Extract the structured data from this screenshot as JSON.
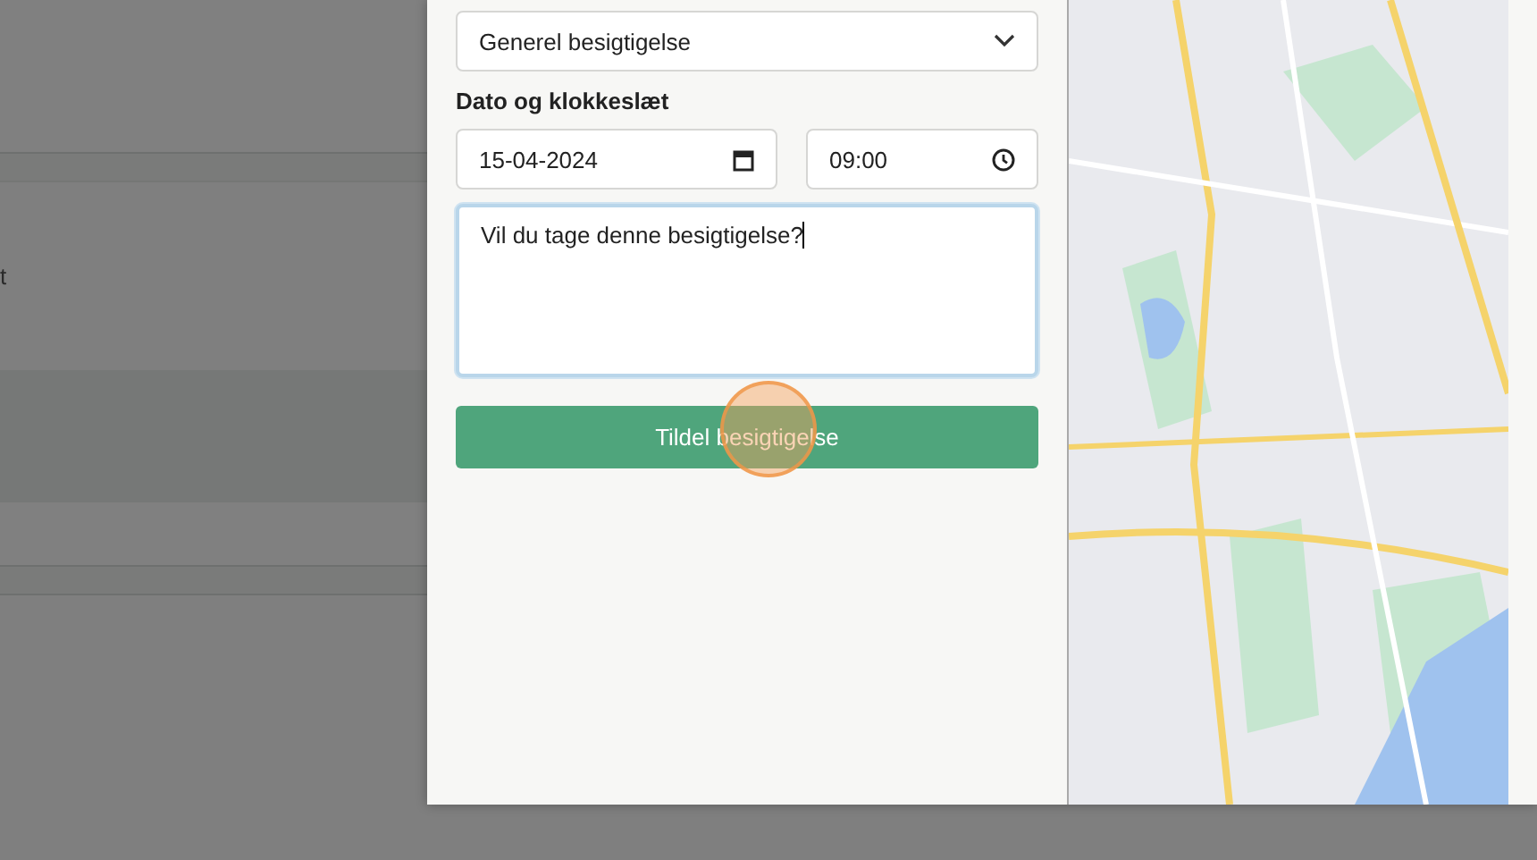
{
  "background_page": {
    "text": "t"
  },
  "dialog": {
    "type_select": {
      "value": "Generel besigtigelse"
    },
    "datetime_label": "Dato og klokkeslæt",
    "date_field": {
      "value": "15-04-2024"
    },
    "time_field": {
      "value": "09:00"
    },
    "message_field": {
      "value": "Vil du tage denne besigtigelse?"
    },
    "submit_button": {
      "label": "Tildel besigtigelse"
    }
  }
}
